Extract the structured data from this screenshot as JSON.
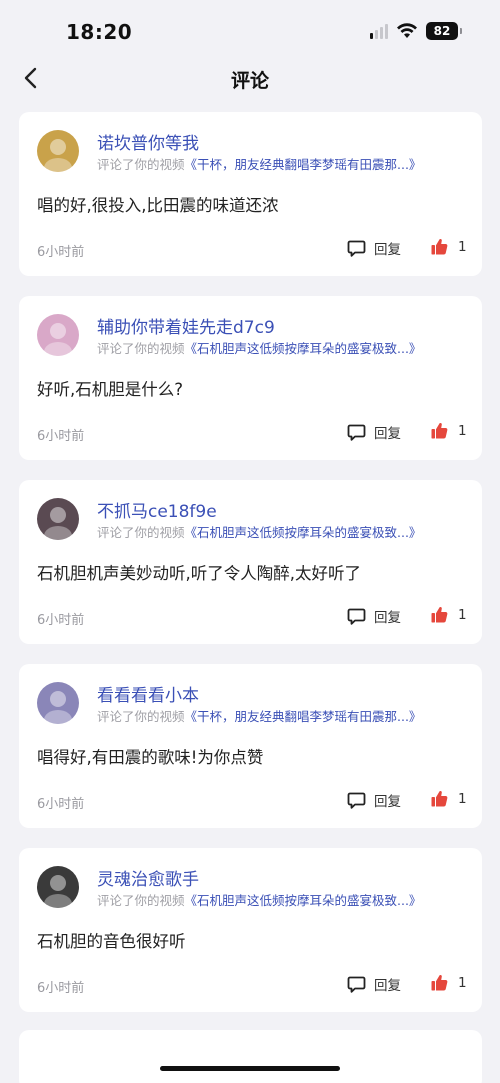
{
  "status_bar": {
    "time": "18:20",
    "battery": "82",
    "icons": [
      "signal-icon",
      "wifi-icon",
      "battery-icon"
    ]
  },
  "nav": {
    "title": "评论",
    "back_icon": "chevron-left-icon"
  },
  "comments": [
    {
      "username": "诺坎普你等我",
      "action": "评论了你的视频",
      "video": "《干杯，朋友经典翻唱李梦瑶有田震那...》",
      "content": "唱的好,很投入,比田震的味道还浓",
      "time": "6小时前",
      "reply_label": "回复",
      "likes": "1",
      "avatar_color": "#c9a24a"
    },
    {
      "username": "辅助你带着娃先走d7c9",
      "action": "评论了你的视频",
      "video": "《石机胆声这低频按摩耳朵的盛宴极致...》",
      "content": "好听,石机胆是什么?",
      "time": "6小时前",
      "reply_label": "回复",
      "likes": "1",
      "avatar_color": "#d9a8c8"
    },
    {
      "username": "不抓马ce18f9e",
      "action": "评论了你的视频",
      "video": "《石机胆声这低频按摩耳朵的盛宴极致...》",
      "content": "石机胆机声美妙动听,听了令人陶醉,太好听了",
      "time": "6小时前",
      "reply_label": "回复",
      "likes": "1",
      "avatar_color": "#5a4a52"
    },
    {
      "username": "看看看看小本",
      "action": "评论了你的视频",
      "video": "《干杯，朋友经典翻唱李梦瑶有田震那...》",
      "content": "唱得好,有田震的歌味!为你点赞",
      "time": "6小时前",
      "reply_label": "回复",
      "likes": "1",
      "avatar_color": "#8a86b8"
    },
    {
      "username": "灵魂治愈歌手",
      "action": "评论了你的视频",
      "video": "《石机胆声这低频按摩耳朵的盛宴极致...》",
      "content": "石机胆的音色很好听",
      "time": "6小时前",
      "reply_label": "回复",
      "likes": "1",
      "avatar_color": "#3a3a3a"
    }
  ],
  "colors": {
    "accent": "#3b50b6",
    "like": "#e5473c",
    "background": "#f2f2f6"
  }
}
